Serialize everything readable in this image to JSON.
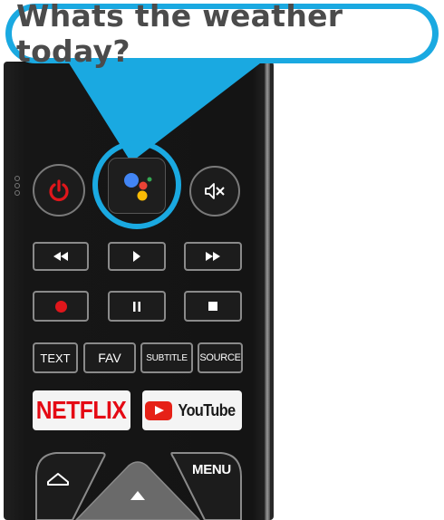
{
  "bubble": {
    "text": "Whats the weather today?"
  },
  "remote": {
    "power_icon": "power-icon",
    "assistant_icon": "google-assistant-icon",
    "mute_icon": "mute-icon",
    "media_row1": [
      "rewind-icon",
      "play-icon",
      "fast-forward-icon"
    ],
    "media_row2": [
      "record-icon",
      "pause-icon",
      "stop-icon"
    ],
    "text_buttons": {
      "text": "TEXT",
      "fav": "FAV",
      "subtitle": "SUBTITLE",
      "source": "SOURCE"
    },
    "netflix_label": "NETFLIX",
    "youtube_label": "YouTube",
    "menu_label": "MENU",
    "home_icon": "home-icon",
    "dpad_up_icon": "up-arrow-icon"
  },
  "colors": {
    "highlight": "#1aa9e1",
    "power_red": "#e0161b",
    "netflix_red": "#e50914",
    "youtube_red": "#e62117",
    "assistant_blue": "#4285f4",
    "assistant_red": "#ea4335",
    "assistant_yellow": "#fbbc05",
    "assistant_green": "#34a853"
  }
}
